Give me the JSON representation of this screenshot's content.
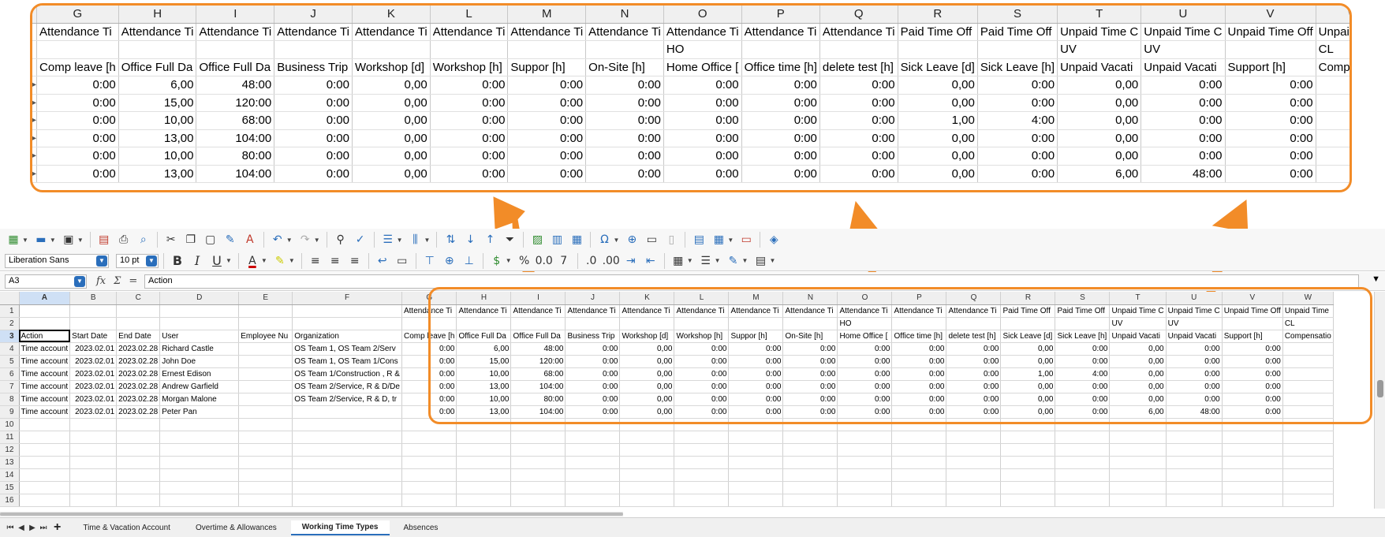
{
  "zoom": {
    "columns": [
      "G",
      "H",
      "I",
      "J",
      "K",
      "L",
      "M",
      "N",
      "O",
      "P",
      "Q",
      "R",
      "S",
      "T",
      "U",
      "V",
      "W"
    ],
    "row1": [
      "Attendance Ti",
      "Attendance Ti",
      "Attendance Ti",
      "Attendance Ti",
      "Attendance Ti",
      "Attendance Ti",
      "Attendance Ti",
      "Attendance Ti",
      "Attendance Ti",
      "Attendance Ti",
      "Attendance Ti",
      "Paid Time Off",
      "Paid Time Off",
      "Unpaid Time C",
      "Unpaid Time C",
      "Unpaid Time Off",
      "Unpaid Time"
    ],
    "row2": [
      "",
      "",
      "",
      "",
      "",
      "",
      "",
      "",
      "HO",
      "",
      "",
      "",
      "",
      "UV",
      "UV",
      "",
      "CL"
    ],
    "row3": [
      "Comp leave [h",
      "Office Full Da",
      "Office Full Da",
      "Business Trip",
      "Workshop [d]",
      "Workshop [h]",
      "Suppor [h]",
      "On-Site [h]",
      "Home Office [",
      "Office time [h]",
      "delete test [h]",
      "Sick Leave [d]",
      "Sick Leave [h]",
      "Unpaid Vacati",
      "Unpaid Vacati",
      "Support [h]",
      "Compensatio"
    ],
    "data": [
      [
        "0:00",
        "6,00",
        "48:00",
        "0:00",
        "0,00",
        "0:00",
        "0:00",
        "0:00",
        "0:00",
        "0:00",
        "0:00",
        "0,00",
        "0:00",
        "0,00",
        "0:00",
        "0:00",
        ""
      ],
      [
        "0:00",
        "15,00",
        "120:00",
        "0:00",
        "0,00",
        "0:00",
        "0:00",
        "0:00",
        "0:00",
        "0:00",
        "0:00",
        "0,00",
        "0:00",
        "0,00",
        "0:00",
        "0:00",
        ""
      ],
      [
        "0:00",
        "10,00",
        "68:00",
        "0:00",
        "0,00",
        "0:00",
        "0:00",
        "0:00",
        "0:00",
        "0:00",
        "0:00",
        "1,00",
        "4:00",
        "0,00",
        "0:00",
        "0:00",
        ""
      ],
      [
        "0:00",
        "13,00",
        "104:00",
        "0:00",
        "0,00",
        "0:00",
        "0:00",
        "0:00",
        "0:00",
        "0:00",
        "0:00",
        "0,00",
        "0:00",
        "0,00",
        "0:00",
        "0:00",
        ""
      ],
      [
        "0:00",
        "10,00",
        "80:00",
        "0:00",
        "0,00",
        "0:00",
        "0:00",
        "0:00",
        "0:00",
        "0:00",
        "0:00",
        "0,00",
        "0:00",
        "0,00",
        "0:00",
        "0:00",
        ""
      ],
      [
        "0:00",
        "13,00",
        "104:00",
        "0:00",
        "0,00",
        "0:00",
        "0:00",
        "0:00",
        "0:00",
        "0:00",
        "0:00",
        "0,00",
        "0:00",
        "6,00",
        "48:00",
        "0:00",
        ""
      ]
    ]
  },
  "toolbar": {
    "font_name": "Liberation Sans",
    "font_size": "10 pt"
  },
  "formula_bar": {
    "name_box": "A3",
    "fx": "fx",
    "sum": "Σ",
    "equals": "=",
    "content": "Action"
  },
  "grid": {
    "columns": [
      "A",
      "B",
      "C",
      "D",
      "E",
      "F",
      "G",
      "H",
      "I",
      "J",
      "K",
      "L",
      "M",
      "N",
      "O",
      "P",
      "Q",
      "R",
      "S",
      "T",
      "U",
      "V",
      "W"
    ],
    "row_numbers": [
      "1",
      "2",
      "3",
      "4",
      "5",
      "6",
      "7",
      "8",
      "9",
      "10",
      "11",
      "12",
      "13",
      "14",
      "15",
      "16"
    ],
    "rows": [
      [
        "",
        "",
        "",
        "",
        "",
        "",
        "Attendance Ti",
        "Attendance Ti",
        "Attendance Ti",
        "Attendance Ti",
        "Attendance Ti",
        "Attendance Ti",
        "Attendance Ti",
        "Attendance Ti",
        "Attendance Ti",
        "Attendance Ti",
        "Attendance Ti",
        "Paid Time Off",
        "Paid Time Off",
        "Unpaid Time C",
        "Unpaid Time C",
        "Unpaid Time Off",
        "Unpaid Time"
      ],
      [
        "",
        "",
        "",
        "",
        "",
        "",
        "",
        "",
        "",
        "",
        "",
        "",
        "",
        "",
        "HO",
        "",
        "",
        "",
        "",
        "UV",
        "UV",
        "",
        "CL"
      ],
      [
        "Action",
        "Start Date",
        "End Date",
        "User",
        "Employee Nu",
        "Organization",
        "Comp leave [h",
        "Office Full Da",
        "Office Full Da",
        "Business Trip",
        "Workshop [d]",
        "Workshop [h]",
        "Suppor [h]",
        "On-Site [h]",
        "Home Office [",
        "Office time [h]",
        "delete test [h]",
        "Sick Leave [d]",
        "Sick Leave [h]",
        "Unpaid Vacati",
        "Unpaid Vacati",
        "Support [h]",
        "Compensatio"
      ],
      [
        "Time account",
        "2023.02.01",
        "2023.02.28",
        "Richard Castle",
        "",
        "OS Team 1, OS Team 2/Serv",
        "0:00",
        "6,00",
        "48:00",
        "0:00",
        "0,00",
        "0:00",
        "0:00",
        "0:00",
        "0:00",
        "0:00",
        "0:00",
        "0,00",
        "0:00",
        "0,00",
        "0:00",
        "0:00",
        ""
      ],
      [
        "Time account",
        "2023.02.01",
        "2023.02.28",
        "John Doe",
        "",
        "OS Team 1, OS Team 1/Cons",
        "0:00",
        "15,00",
        "120:00",
        "0:00",
        "0,00",
        "0:00",
        "0:00",
        "0:00",
        "0:00",
        "0:00",
        "0:00",
        "0,00",
        "0:00",
        "0,00",
        "0:00",
        "0:00",
        ""
      ],
      [
        "Time account",
        "2023.02.01",
        "2023.02.28",
        "Ernest Edison",
        "",
        "OS Team 1/Construction , R &",
        "0:00",
        "10,00",
        "68:00",
        "0:00",
        "0,00",
        "0:00",
        "0:00",
        "0:00",
        "0:00",
        "0:00",
        "0:00",
        "1,00",
        "4:00",
        "0,00",
        "0:00",
        "0:00",
        ""
      ],
      [
        "Time account",
        "2023.02.01",
        "2023.02.28",
        "Andrew Garfield",
        "",
        "OS Team 2/Service, R & D/De",
        "0:00",
        "13,00",
        "104:00",
        "0:00",
        "0,00",
        "0:00",
        "0:00",
        "0:00",
        "0:00",
        "0:00",
        "0:00",
        "0,00",
        "0:00",
        "0,00",
        "0:00",
        "0:00",
        ""
      ],
      [
        "Time account",
        "2023.02.01",
        "2023.02.28",
        "Morgan Malone",
        "",
        "OS Team 2/Service, R & D, tr",
        "0:00",
        "10,00",
        "80:00",
        "0:00",
        "0,00",
        "0:00",
        "0:00",
        "0:00",
        "0:00",
        "0:00",
        "0:00",
        "0,00",
        "0:00",
        "0,00",
        "0:00",
        "0:00",
        ""
      ],
      [
        "Time account",
        "2023.02.01",
        "2023.02.28",
        "Peter Pan",
        "",
        "",
        "0:00",
        "13,00",
        "104:00",
        "0:00",
        "0,00",
        "0:00",
        "0:00",
        "0:00",
        "0:00",
        "0:00",
        "0:00",
        "0,00",
        "0:00",
        "6,00",
        "48:00",
        "0:00",
        ""
      ]
    ]
  },
  "sheet_tabs": [
    "Time & Vacation Account",
    "Overtime & Allowances",
    "Working Time Types",
    "Absences"
  ],
  "active_tab": "Working Time Types",
  "colors": {
    "accent": "#f28c28",
    "selection": "#2a6ebb"
  }
}
